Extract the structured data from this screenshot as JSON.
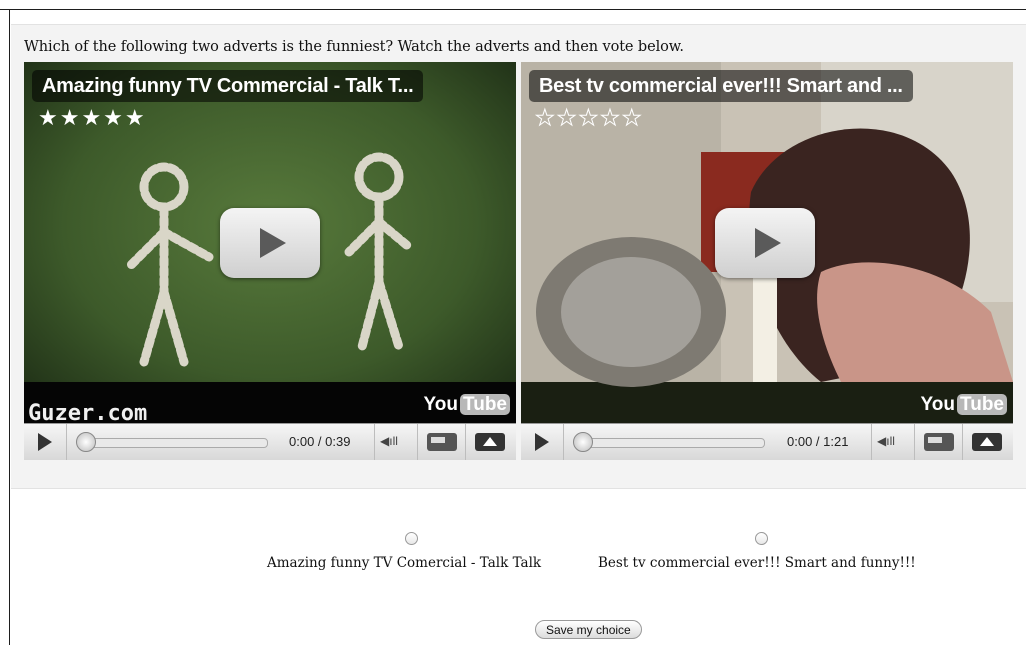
{
  "question": "Which of the following two adverts is the funniest? Watch the adverts and then vote below.",
  "videos": [
    {
      "title": "Amazing funny TV Commercial - Talk T...",
      "stars": "★★★★★",
      "watermark": "Guzer.com",
      "logo_you": "You",
      "logo_tube": "Tube",
      "time": "0:00 / 0:39",
      "rating_shown": 5
    },
    {
      "title": "Best tv commercial ever!!! Smart and ...",
      "stars": "★★★★★",
      "logo_you": "You",
      "logo_tube": "Tube",
      "time": "0:00 / 1:21",
      "rating_shown": 0
    }
  ],
  "vote": {
    "options": [
      {
        "label": "Amazing funny TV Comercial - Talk Talk",
        "selected": false
      },
      {
        "label": "Best tv commercial ever!!! Smart and funny!!!",
        "selected": false
      }
    ],
    "save_label": "Save my choice"
  },
  "icons": {
    "play": "play-icon",
    "volume": "volume-icon",
    "size": "window-size-icon",
    "fullscreen": "fullscreen-icon"
  },
  "colors": {
    "panel_bg": "#f3f3f3",
    "text": "#111111"
  }
}
